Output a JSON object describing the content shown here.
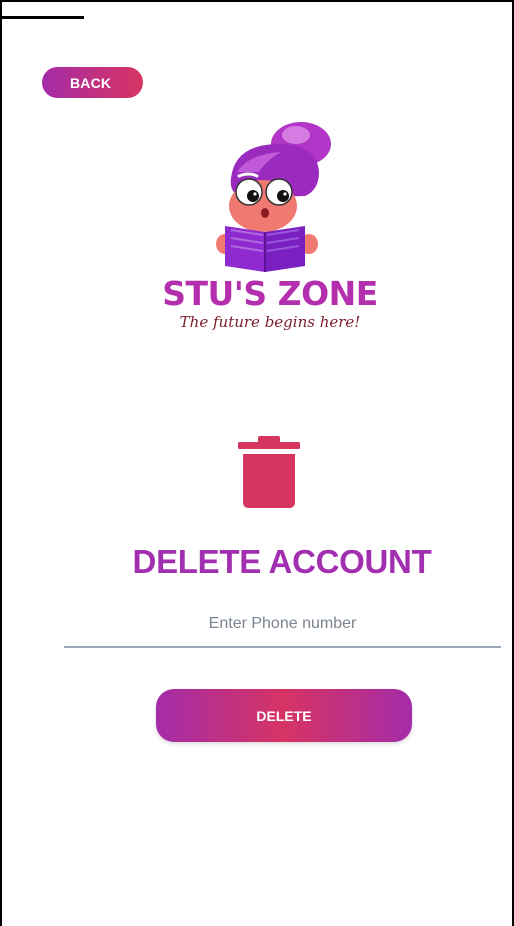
{
  "header": {
    "back_label": "BACK"
  },
  "brand": {
    "name": "STU'S ZONE",
    "tagline": "The future begins here!"
  },
  "main": {
    "title": "DELETE ACCOUNT",
    "phone_placeholder": "Enter Phone number",
    "phone_value": "",
    "delete_label": "DELETE"
  },
  "icons": {
    "trash": "trash-icon",
    "logo": "reading-kid-mascot"
  },
  "colors": {
    "accent_purple": "#a42ca8",
    "accent_pink": "#d63463",
    "title_purple": "#a22fb0",
    "trash_color": "#d6355f",
    "underline": "#9aa7b4"
  }
}
